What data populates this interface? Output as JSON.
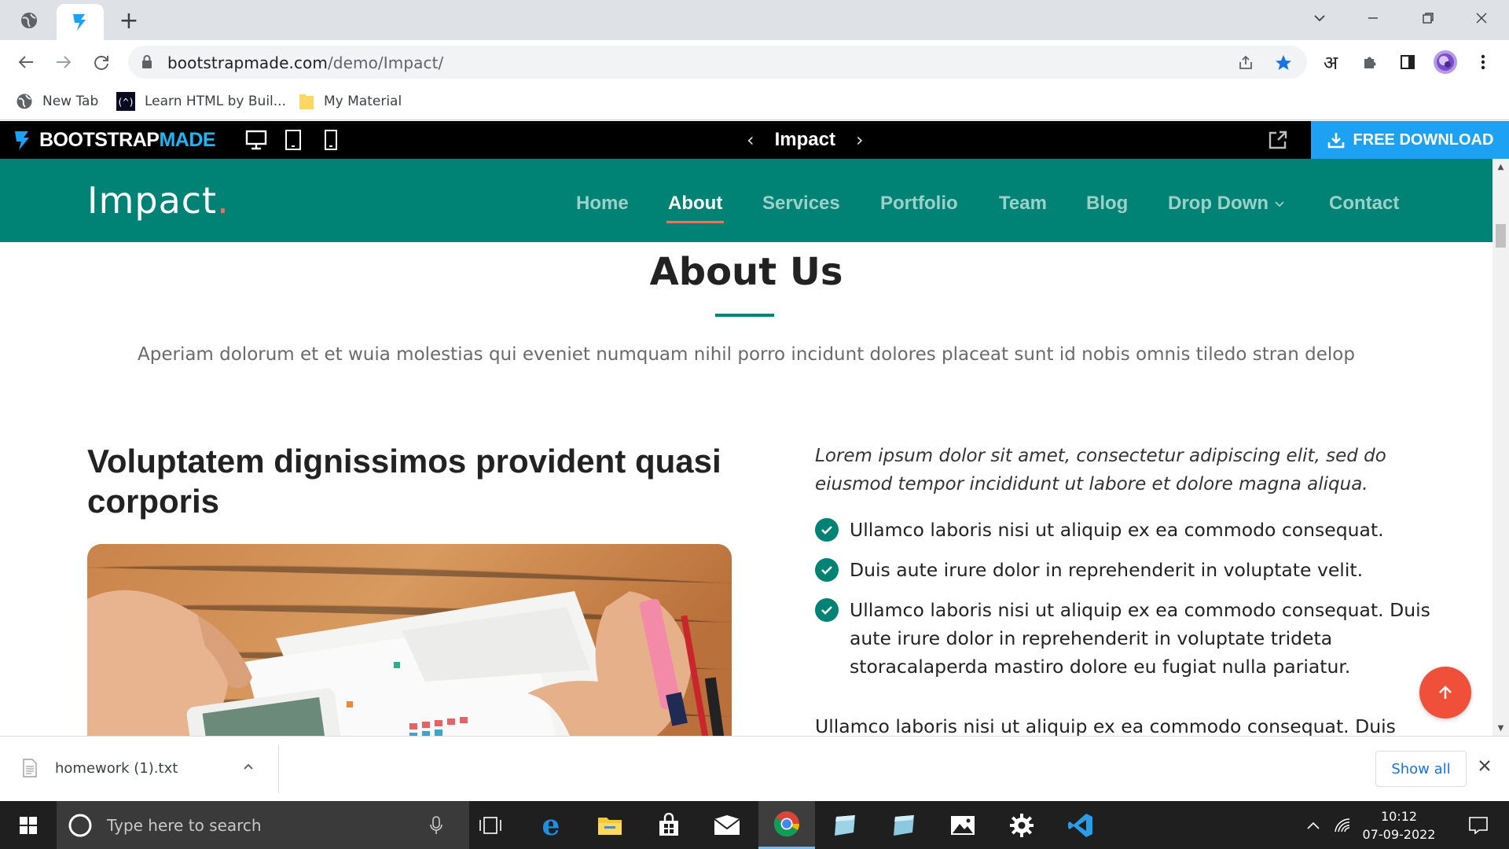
{
  "browser": {
    "url_host": "bootstrapmade.com",
    "url_path": "/demo/Impact/",
    "bookmarks": [
      {
        "label": "New Tab",
        "icon": "globe-icon"
      },
      {
        "label": "Learn HTML by Buil...",
        "icon": "freecodecamp-icon"
      },
      {
        "label": "My Material",
        "icon": "folder-icon"
      }
    ],
    "hindi_ext_label": "अ"
  },
  "bmbar": {
    "logo_part1": "BOOTSTRAP",
    "logo_part2": "MADE",
    "center_title": "Impact",
    "download_label": "FREE DOWNLOAD"
  },
  "site": {
    "logo": "Impact",
    "logo_dot": ".",
    "nav": [
      {
        "label": "Home",
        "active": false
      },
      {
        "label": "About",
        "active": true
      },
      {
        "label": "Services",
        "active": false
      },
      {
        "label": "Portfolio",
        "active": false
      },
      {
        "label": "Team",
        "active": false
      },
      {
        "label": "Blog",
        "active": false
      },
      {
        "label": "Drop Down",
        "active": false,
        "dropdown": true
      },
      {
        "label": "Contact",
        "active": false
      }
    ]
  },
  "about": {
    "title": "About Us",
    "subtitle": "Aperiam dolorum et et wuia molestias qui eveniet numquam nihil porro incidunt dolores placeat sunt id nobis omnis tiledo stran delop",
    "heading": "Voluptatem dignissimos provident quasi corporis",
    "intro": "Lorem ipsum dolor sit amet, consectetur adipiscing elit, sed do eiusmod tempor incididunt ut labore et dolore magna aliqua.",
    "checks": [
      "Ullamco laboris nisi ut aliquip ex ea commodo consequat.",
      "Duis aute irure dolor in reprehenderit in voluptate velit.",
      "Ullamco laboris nisi ut aliquip ex ea commodo consequat. Duis aute irure dolor in reprehenderit in voluptate trideta storacalaperda mastiro dolore eu fugiat nulla pariatur."
    ],
    "paragraph": "Ullamco laboris nisi ut aliquip ex ea commodo consequat. Duis"
  },
  "downloads": {
    "file": "homework (1).txt",
    "show_all": "Show all"
  },
  "taskbar": {
    "search_placeholder": "Type here to search",
    "time": "10:12",
    "date": "07-09-2022"
  },
  "colors": {
    "brand_teal": "#008374",
    "accent_orange": "#f96f59",
    "download_blue": "#1da1f2"
  }
}
